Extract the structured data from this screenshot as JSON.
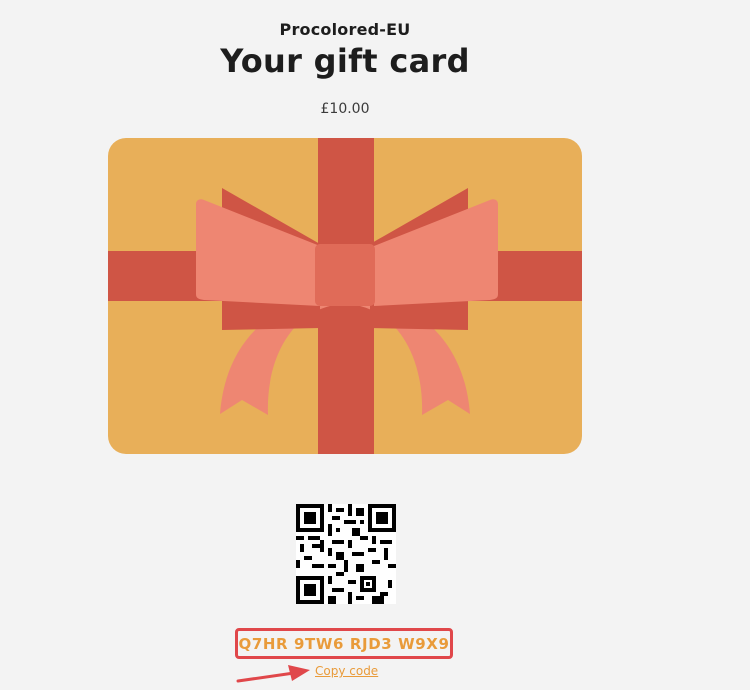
{
  "header": {
    "shop_name": "Procolored-EU",
    "title": "Your gift card",
    "amount": "£10.00"
  },
  "card": {
    "image": "gift-card-illustration",
    "colors": {
      "card": "#e8af59",
      "ribbon": "#cf5545",
      "bow": "#ee8672",
      "knot": "#e06b58"
    }
  },
  "qr": {
    "icon": "qr-code"
  },
  "gift_code": {
    "code": "Q7HR 9TW6 RJD3 W9X9",
    "copy_label": "Copy code",
    "highlight_color": "#e0474a",
    "text_color": "#e99b3a"
  },
  "annotation": {
    "arrow_color": "#e0474a"
  }
}
